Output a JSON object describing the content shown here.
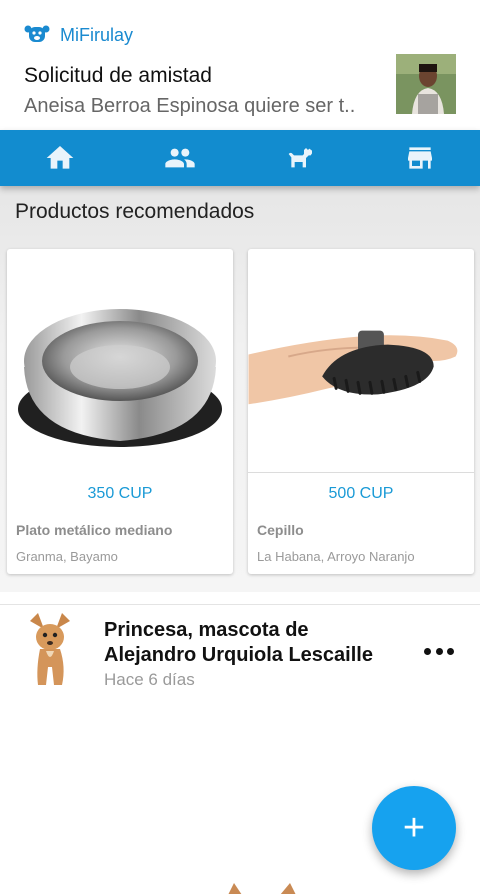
{
  "notification": {
    "app_name": "MiFirulay",
    "title": "Solicitud de amistad",
    "body": "Aneisa Berroa Espinosa quiere ser t.."
  },
  "tabs": [
    {
      "icon": "home-icon"
    },
    {
      "icon": "people-icon"
    },
    {
      "icon": "pet-icon"
    },
    {
      "icon": "store-icon"
    }
  ],
  "products": {
    "section_title": "Productos recomendados",
    "items": [
      {
        "price": "350 CUP",
        "name": "Plato metálico mediano",
        "location": "Granma, Bayamo",
        "image": "steel-bowl-image"
      },
      {
        "price": "500 CUP",
        "name": "Cepillo",
        "location": "La Habana, Arroyo Naranjo",
        "image": "grooming-brush-image"
      }
    ]
  },
  "post": {
    "title": "Princesa, mascota de Alejandro Urquiola Lescaille",
    "time": "Hace 6 días"
  },
  "fab": {
    "label": "+"
  },
  "colors": {
    "accent": "#128ccf",
    "fab": "#16a2ef",
    "price": "#1a9ad6"
  }
}
